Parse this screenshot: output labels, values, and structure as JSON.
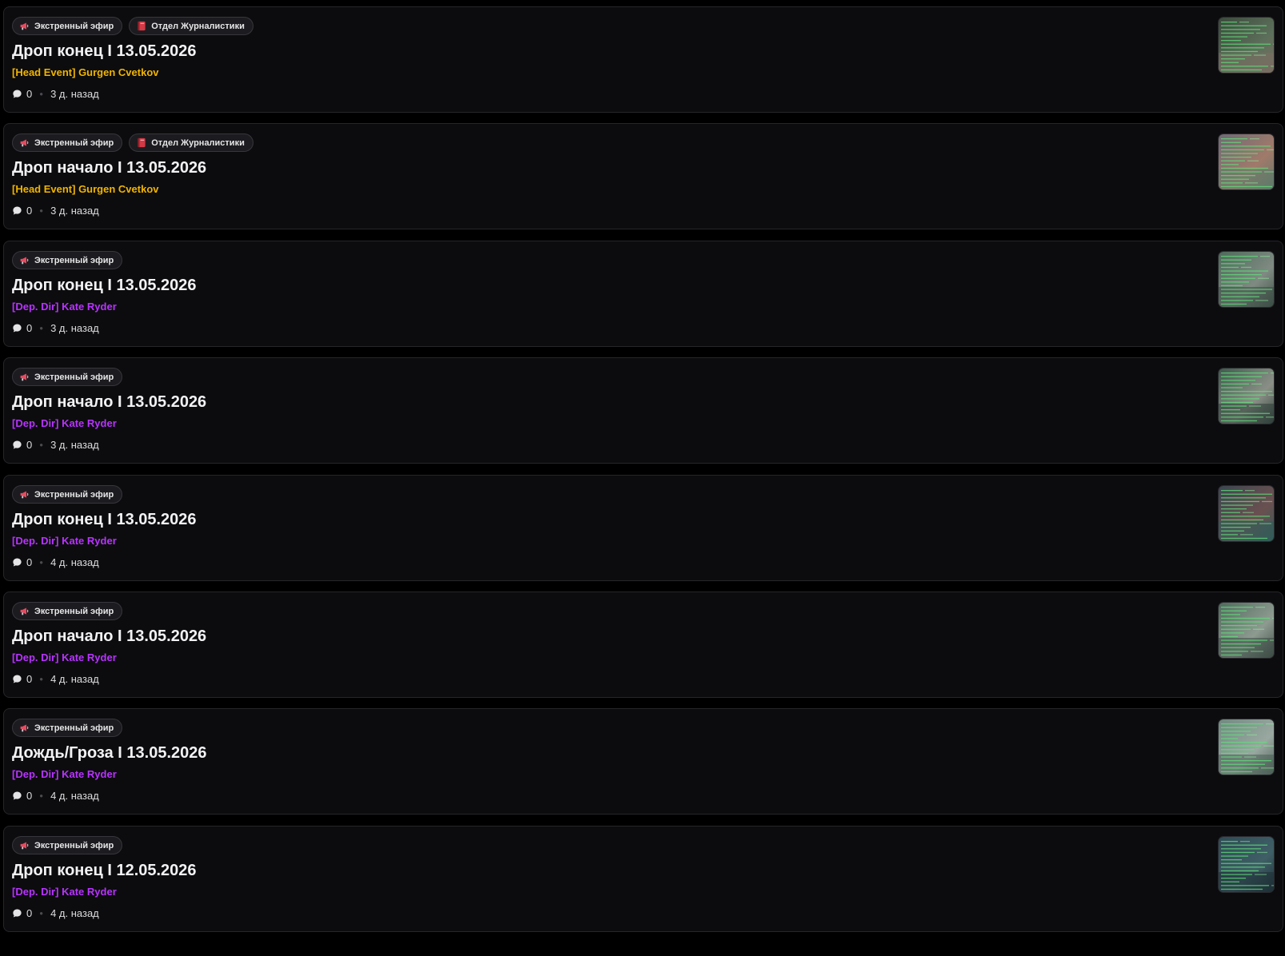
{
  "colors": {
    "author_head_event": "#f0b400",
    "author_dep_dir": "#b833ff",
    "tag_background": "#1c1c20",
    "card_background": "#0c0c0e"
  },
  "icons": {
    "megaphone": "megaphone-icon",
    "book": "red-book-icon",
    "comment": "speech-bubble-icon"
  },
  "posts": [
    {
      "tags": [
        {
          "label": "Экстренный эфир",
          "icon": "megaphone-icon"
        },
        {
          "label": "Отдел Журналистики",
          "icon": "red-book-icon"
        }
      ],
      "title": "Дроп конец I 13.05.2026",
      "author": "[Head Event] Gurgen Cvetkov",
      "author_color": "#f0b400",
      "comments": "0",
      "time": "3 д. назад"
    },
    {
      "tags": [
        {
          "label": "Экстренный эфир",
          "icon": "megaphone-icon"
        },
        {
          "label": "Отдел Журналистики",
          "icon": "red-book-icon"
        }
      ],
      "title": "Дроп начало I 13.05.2026",
      "author": "[Head Event] Gurgen Cvetkov",
      "author_color": "#f0b400",
      "comments": "0",
      "time": "3 д. назад"
    },
    {
      "tags": [
        {
          "label": "Экстренный эфир",
          "icon": "megaphone-icon"
        }
      ],
      "title": "Дроп конец I 13.05.2026",
      "author": "[Dep. Dir] Kate Ryder",
      "author_color": "#b833ff",
      "comments": "0",
      "time": "3 д. назад"
    },
    {
      "tags": [
        {
          "label": "Экстренный эфир",
          "icon": "megaphone-icon"
        }
      ],
      "title": "Дроп начало I 13.05.2026",
      "author": "[Dep. Dir] Kate Ryder",
      "author_color": "#b833ff",
      "comments": "0",
      "time": "3 д. назад"
    },
    {
      "tags": [
        {
          "label": "Экстренный эфир",
          "icon": "megaphone-icon"
        }
      ],
      "title": "Дроп конец I 13.05.2026",
      "author": "[Dep. Dir] Kate Ryder",
      "author_color": "#b833ff",
      "comments": "0",
      "time": "4 д. назад"
    },
    {
      "tags": [
        {
          "label": "Экстренный эфир",
          "icon": "megaphone-icon"
        }
      ],
      "title": "Дроп начало I 13.05.2026",
      "author": "[Dep. Dir] Kate Ryder",
      "author_color": "#b833ff",
      "comments": "0",
      "time": "4 д. назад"
    },
    {
      "tags": [
        {
          "label": "Экстренный эфир",
          "icon": "megaphone-icon"
        }
      ],
      "title": "Дождь/Гроза I 13.05.2026",
      "author": "[Dep. Dir] Kate Ryder",
      "author_color": "#b833ff",
      "comments": "0",
      "time": "4 д. назад"
    },
    {
      "tags": [
        {
          "label": "Экстренный эфир",
          "icon": "megaphone-icon"
        }
      ],
      "title": "Дроп конец I 12.05.2026",
      "author": "[Dep. Dir] Kate Ryder",
      "author_color": "#b833ff",
      "comments": "0",
      "time": "4 д. назад"
    }
  ]
}
